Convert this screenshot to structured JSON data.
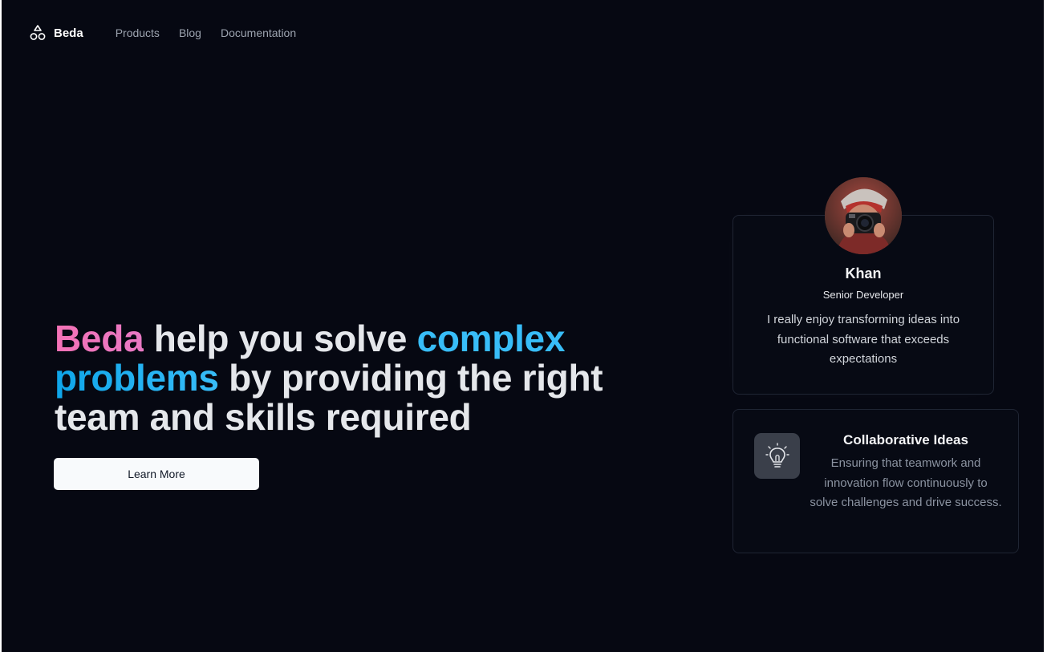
{
  "nav": {
    "brand": "Beda",
    "links": [
      "Products",
      "Blog",
      "Documentation"
    ]
  },
  "hero": {
    "headline": {
      "part1": "Beda",
      "part2": " help you solve ",
      "part3": "complex",
      "part4": "problems",
      "part5": " by providing the right team and skills required"
    },
    "cta_label": "Learn More"
  },
  "profile_card": {
    "name": "Khan",
    "role": "Senior Developer",
    "quote": "I really enjoy transforming ideas into functional software that exceeds expectations",
    "avatar_icon": "person-with-camera-photo"
  },
  "feature_card": {
    "icon": "lightbulb-icon",
    "title": "Collaborative Ideas",
    "description": "Ensuring that teamwork and innovation flow continuously to solve challenges and drive success."
  },
  "colors": {
    "background": "#060812",
    "accent_pink": "#f472b6",
    "accent_cyan": "#38bdf8",
    "button_bg": "#f8fafc"
  }
}
